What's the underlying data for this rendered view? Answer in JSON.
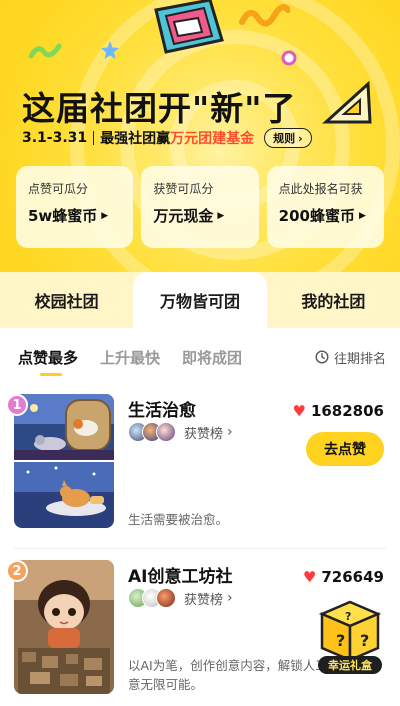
{
  "hero": {
    "title": "这届社团开\"新\"了",
    "date": "3.1-3.31",
    "sub_prefix": "最强社团赢",
    "sub_highlight": "万元团建基金",
    "rules_label": "规则",
    "colors": {
      "background": "#ffd420",
      "highlight": "#ff4d2e"
    }
  },
  "reward_cards": [
    {
      "title": "点赞可瓜分",
      "value": "5w蜂蜜币"
    },
    {
      "title": "获赞可瓜分",
      "value": "万元现金"
    },
    {
      "title": "点此处报名可获",
      "value": "200蜂蜜币"
    }
  ],
  "tabs": [
    {
      "label": "校园社团",
      "active": false
    },
    {
      "label": "万物皆可团",
      "active": true
    },
    {
      "label": "我的社团",
      "active": false
    }
  ],
  "subtabs": [
    {
      "label": "点赞最多",
      "active": true
    },
    {
      "label": "上升最快",
      "active": false
    },
    {
      "label": "即将成团",
      "active": false
    }
  ],
  "past_ranking_label": "往期排名",
  "clubs": [
    {
      "rank": "1",
      "name": "生活治愈",
      "likes": "1682806",
      "supporters_label": "获赞榜",
      "description": "生活需要被治愈。",
      "button": "去点赞",
      "rank_color": "#e57bd0"
    },
    {
      "rank": "2",
      "name": "AI创意工坊社",
      "likes": "726649",
      "supporters_label": "获赞榜",
      "description": "以AI为笔，创作创意内容，解锁人工智能的创意无限可能。",
      "rank_color": "#f5a25a"
    }
  ],
  "floating_gift": {
    "label": "幸运礼盒"
  }
}
